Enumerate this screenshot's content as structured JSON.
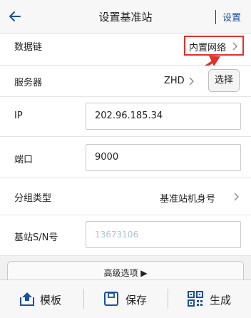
{
  "header": {
    "title": "设置基准站",
    "settings_label": "设置"
  },
  "rows": {
    "data_link": {
      "label": "数据链",
      "value": "内置网络"
    },
    "server": {
      "label": "服务器",
      "value": "ZHD",
      "button": "选择"
    },
    "ip": {
      "label": "IP",
      "value": "202.96.185.34"
    },
    "port": {
      "label": "端口",
      "value": "9000"
    },
    "group_type": {
      "label": "分组类型",
      "value": "基准站机身号"
    },
    "base_sn": {
      "label": "基站S/N号",
      "placeholder": "13673106"
    }
  },
  "advanced": {
    "label": "高级选项 ▶"
  },
  "bottom": {
    "template": "模板",
    "save": "保存",
    "generate": "生成"
  },
  "colors": {
    "accent": "#1a4fa0",
    "highlight": "#e0322b"
  }
}
